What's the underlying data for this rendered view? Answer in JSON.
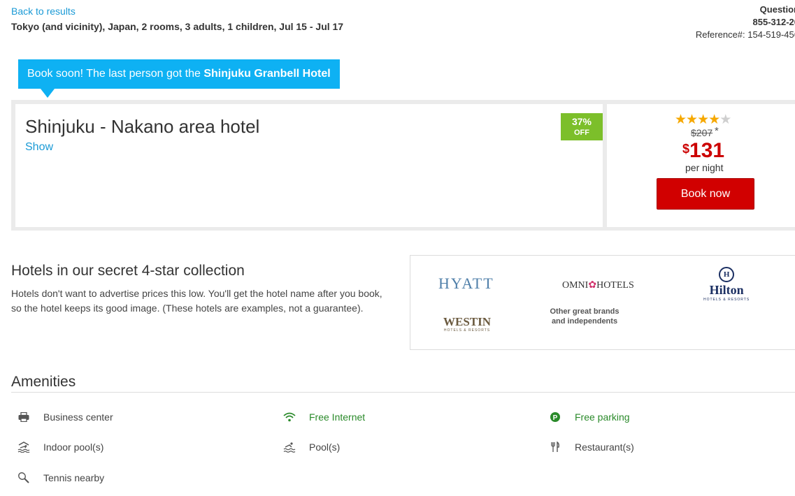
{
  "header": {
    "back_link": "Back to results",
    "search_summary": "Tokyo (and vicinity), Japan, 2 rooms, 3 adults, 1 children, Jul 15 - Jul 17",
    "questions_label": "Question",
    "phone": "855-312-20",
    "reference": "Reference#: 154-519-456"
  },
  "banner": {
    "text_prefix": "Book soon! The last person got the ",
    "hotel_name": "Shinjuku Granbell Hotel"
  },
  "hotel": {
    "title": "Shinjuku - Nakano area hotel",
    "show_link": "Show",
    "discount_percent": "37%",
    "discount_off": "OFF",
    "stars_filled": 4,
    "stars_total": 5,
    "old_price": "$207",
    "asterisk": "*",
    "currency": "$",
    "price": "131",
    "per_night": "per night",
    "book_button": "Book now"
  },
  "collection": {
    "title": "Hotels in our secret 4-star collection",
    "description": "Hotels don't want to advertise prices this low. You'll get the hotel name after you book, so the hotel keeps its good image. (These hotels are examples, not a guarantee).",
    "brands": {
      "hyatt": "HYATT",
      "omni": "OMNI HOTELS",
      "hilton": "Hilton",
      "hilton_sub": "HOTELS & RESORTS",
      "westin": "WESTIN",
      "westin_sub": "HOTELS & RESORTS",
      "other_line1": "Other great brands",
      "other_line2": "and independents"
    }
  },
  "amenities": {
    "title": "Amenities",
    "items": [
      {
        "label": "Business center",
        "icon": "printer-icon",
        "highlight": false
      },
      {
        "label": "Free Internet",
        "icon": "wifi-icon",
        "highlight": true
      },
      {
        "label": "Free parking",
        "icon": "parking-icon",
        "highlight": true
      },
      {
        "label": "Indoor pool(s)",
        "icon": "indoor-pool-icon",
        "highlight": false
      },
      {
        "label": "Pool(s)",
        "icon": "pool-icon",
        "highlight": false
      },
      {
        "label": "Restaurant(s)",
        "icon": "restaurant-icon",
        "highlight": false
      },
      {
        "label": "Tennis nearby",
        "icon": "tennis-icon",
        "highlight": false
      }
    ]
  },
  "colors": {
    "link": "#1a9ad6",
    "banner": "#0eb1f3",
    "discount": "#7cbf2a",
    "price": "#cc0000",
    "book_button": "#d10000",
    "amenity_green": "#2a8a2a",
    "star": "#f6a800"
  }
}
